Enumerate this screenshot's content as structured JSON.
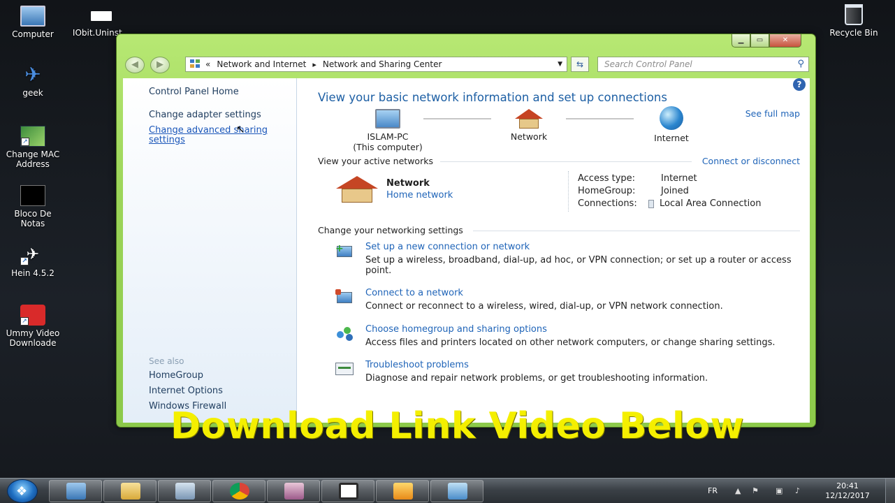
{
  "desktop": {
    "icons": [
      {
        "label": "Computer"
      },
      {
        "label": "IObit.Uninst..."
      },
      {
        "label": "geek"
      },
      {
        "label": "Change MAC Address"
      },
      {
        "label": "Bloco De Notas"
      },
      {
        "label": "Hein 4.5.2"
      },
      {
        "label": "Ummy Video Downloade"
      },
      {
        "label": "Recycle Bin"
      }
    ]
  },
  "window": {
    "address": {
      "overflow": "«",
      "crumbs": [
        "Network and Internet",
        "Network and Sharing Center"
      ],
      "separator": "▸"
    },
    "search_placeholder": "Search Control Panel",
    "sidebar": {
      "home": "Control Panel Home",
      "adapter": "Change adapter settings",
      "advanced": "Change advanced sharing settings",
      "see_also": "See also",
      "homegroup": "HomeGroup",
      "internet_options": "Internet Options",
      "firewall": "Windows Firewall"
    },
    "main": {
      "title": "View your basic network information and set up connections",
      "see_full_map": "See full map",
      "map": {
        "computer_name": "ISLAM-PC",
        "computer_sub": "(This computer)",
        "network": "Network",
        "internet": "Internet"
      },
      "active_label": "View your active networks",
      "connect_disconnect": "Connect or disconnect",
      "active_network": {
        "name": "Network",
        "type": "Home network",
        "access_type_key": "Access type:",
        "access_type_val": "Internet",
        "homegroup_key": "HomeGroup:",
        "homegroup_val": "Joined",
        "connections_key": "Connections:",
        "connections_val": "Local Area Connection"
      },
      "change_label": "Change your networking settings",
      "tasks": [
        {
          "title": "Set up a new connection or network",
          "desc": "Set up a wireless, broadband, dial-up, ad hoc, or VPN connection; or set up a router or access point."
        },
        {
          "title": "Connect to a network",
          "desc": "Connect or reconnect to a wireless, wired, dial-up, or VPN network connection."
        },
        {
          "title": "Choose homegroup and sharing options",
          "desc": "Access files and printers located on other network computers, or change sharing settings."
        },
        {
          "title": "Troubleshoot problems",
          "desc": "Diagnose and repair network problems, or get troubleshooting information."
        }
      ]
    }
  },
  "overlay_caption": "Download Link Video Below",
  "taskbar": {
    "language": "FR",
    "time": "20:41",
    "date": "12/12/2017"
  },
  "colors": {
    "window_frame": "#9dd55a",
    "link": "#1f64b8",
    "title": "#1d5fa4",
    "overlay": "#f4ef00"
  }
}
